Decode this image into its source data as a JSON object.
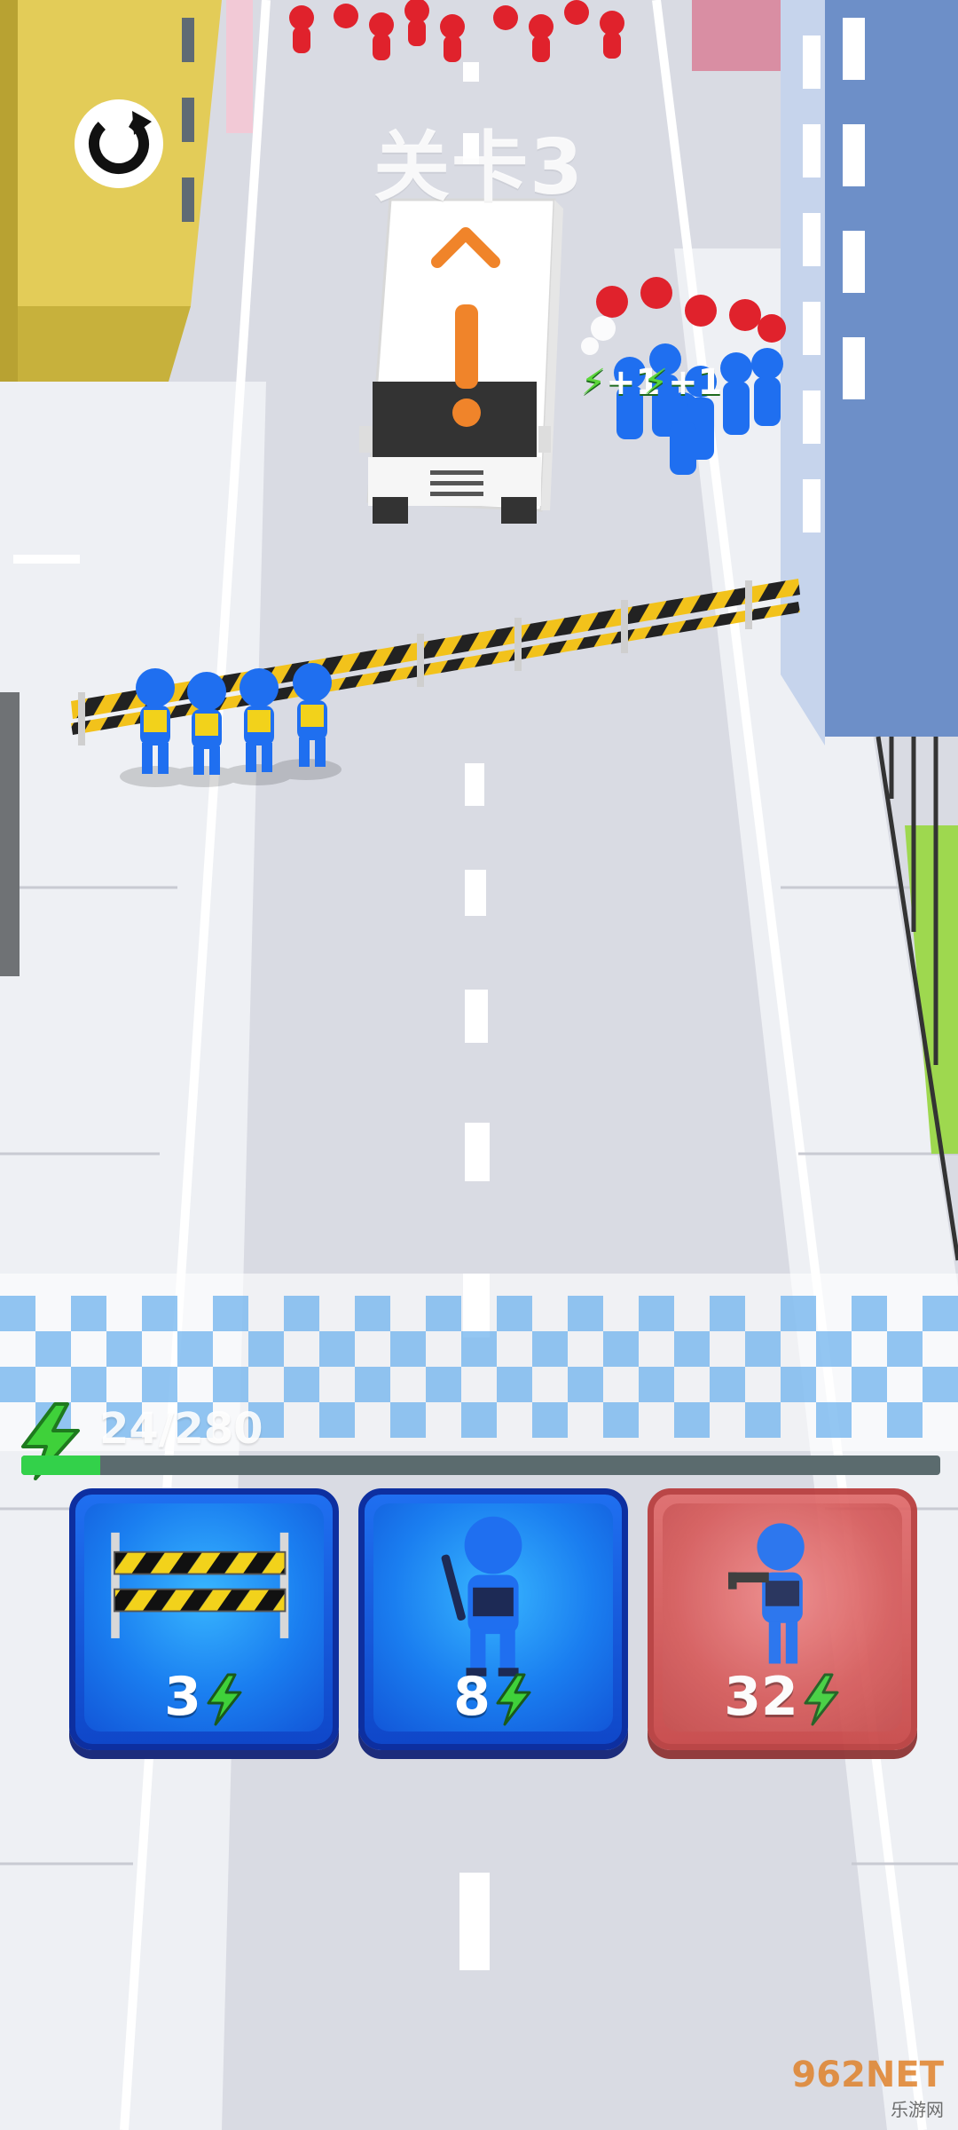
{
  "hud": {
    "level_title": "关卡3",
    "restart_icon": "restart-icon",
    "energy_icon": "lightning-icon",
    "energy_text": "24/280",
    "energy_current": 24,
    "energy_max": 280
  },
  "cards": [
    {
      "unit": "barrier",
      "icon": "barrier-icon",
      "cost": "3",
      "state": "available"
    },
    {
      "unit": "baton-police",
      "icon": "police-baton-icon",
      "cost": "8",
      "state": "available"
    },
    {
      "unit": "gun-police",
      "icon": "police-gun-icon",
      "cost": "32",
      "state": "locked"
    }
  ],
  "scene": {
    "floating_rewards": [
      "+1",
      "+1"
    ]
  },
  "watermark": {
    "brand": "962NET",
    "sub": "乐游网"
  },
  "colors": {
    "ally": "#1f6ff0",
    "enemy": "#e0222c",
    "energy": "#33d14a",
    "card_blue": "#1a7ef0",
    "card_red": "#d65a5a"
  }
}
